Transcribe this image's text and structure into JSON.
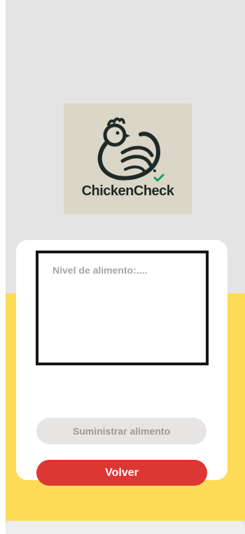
{
  "logo": {
    "name": "ChickenCheck"
  },
  "food": {
    "placeholder": "Nivel de alimento:...."
  },
  "buttons": {
    "supply_label": "Suministrar alimento",
    "back_label": "Volver"
  },
  "colors": {
    "background": "#e4e4e4",
    "accent_yellow": "#fedb56",
    "back_button": "#dd3734",
    "supply_button_disabled": "#e7e4e4"
  },
  "icons": {
    "logo_mark": "chicken-check-icon"
  }
}
